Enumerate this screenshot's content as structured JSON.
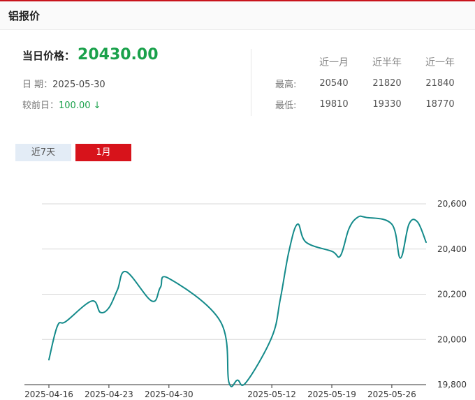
{
  "header": {
    "title": "铝报价"
  },
  "price": {
    "label": "当日价格：",
    "value": "20430.00"
  },
  "date": {
    "label": "日 期：",
    "value": "2025-05-30"
  },
  "change": {
    "label": "较前日：",
    "value": "100.00 ↓"
  },
  "stats": {
    "headers": [
      "近一月",
      "近半年",
      "近一年"
    ],
    "high": {
      "label": "最高:",
      "values": [
        "20540",
        "21820",
        "21840"
      ]
    },
    "low": {
      "label": "最低:",
      "values": [
        "19810",
        "19330",
        "18770"
      ]
    }
  },
  "tabs": [
    {
      "label": "近7天",
      "active": false
    },
    {
      "label": "1月",
      "active": true
    }
  ],
  "colors": {
    "line": "#138a8a",
    "accent": "#d7131b",
    "up_down_green": "#1aa14b"
  },
  "chart_data": {
    "type": "line",
    "title": "",
    "xlabel": "",
    "ylabel": "",
    "ylim": [
      19800,
      20600
    ],
    "yticks": [
      19800,
      20000,
      20200,
      20400,
      20600
    ],
    "ytick_labels": [
      "19,800",
      "20,000",
      "20,200",
      "20,400",
      "20,600"
    ],
    "xtick_labels": [
      "2025-04-16",
      "2025-04-23",
      "2025-04-30",
      "2025-05-12",
      "2025-05-19",
      "2025-05-26"
    ],
    "grid": true,
    "y_axis_position": "right",
    "series": [
      {
        "values": [
          [
            "2025-04-16",
            19910
          ],
          [
            "2025-04-17",
            20060
          ],
          [
            "2025-04-18",
            20080
          ],
          [
            "2025-04-21",
            20170
          ],
          [
            "2025-04-22",
            20120
          ],
          [
            "2025-04-23",
            20140
          ],
          [
            "2025-04-24",
            20220
          ],
          [
            "2025-04-25",
            20300
          ],
          [
            "2025-04-28",
            20170
          ],
          [
            "2025-04-29",
            20230
          ],
          [
            "2025-04-30",
            20270
          ],
          [
            "2025-05-06",
            20080
          ],
          [
            "2025-05-07",
            19810
          ],
          [
            "2025-05-08",
            19820
          ],
          [
            "2025-05-09",
            19810
          ],
          [
            "2025-05-12",
            20010
          ],
          [
            "2025-05-13",
            20180
          ],
          [
            "2025-05-14",
            20390
          ],
          [
            "2025-05-15",
            20510
          ],
          [
            "2025-05-16",
            20430
          ],
          [
            "2025-05-19",
            20390
          ],
          [
            "2025-05-20",
            20370
          ],
          [
            "2025-05-21",
            20490
          ],
          [
            "2025-05-22",
            20540
          ],
          [
            "2025-05-23",
            20540
          ],
          [
            "2025-05-26",
            20510
          ],
          [
            "2025-05-27",
            20360
          ],
          [
            "2025-05-28",
            20510
          ],
          [
            "2025-05-29",
            20520
          ],
          [
            "2025-05-30",
            20430
          ]
        ]
      }
    ]
  }
}
